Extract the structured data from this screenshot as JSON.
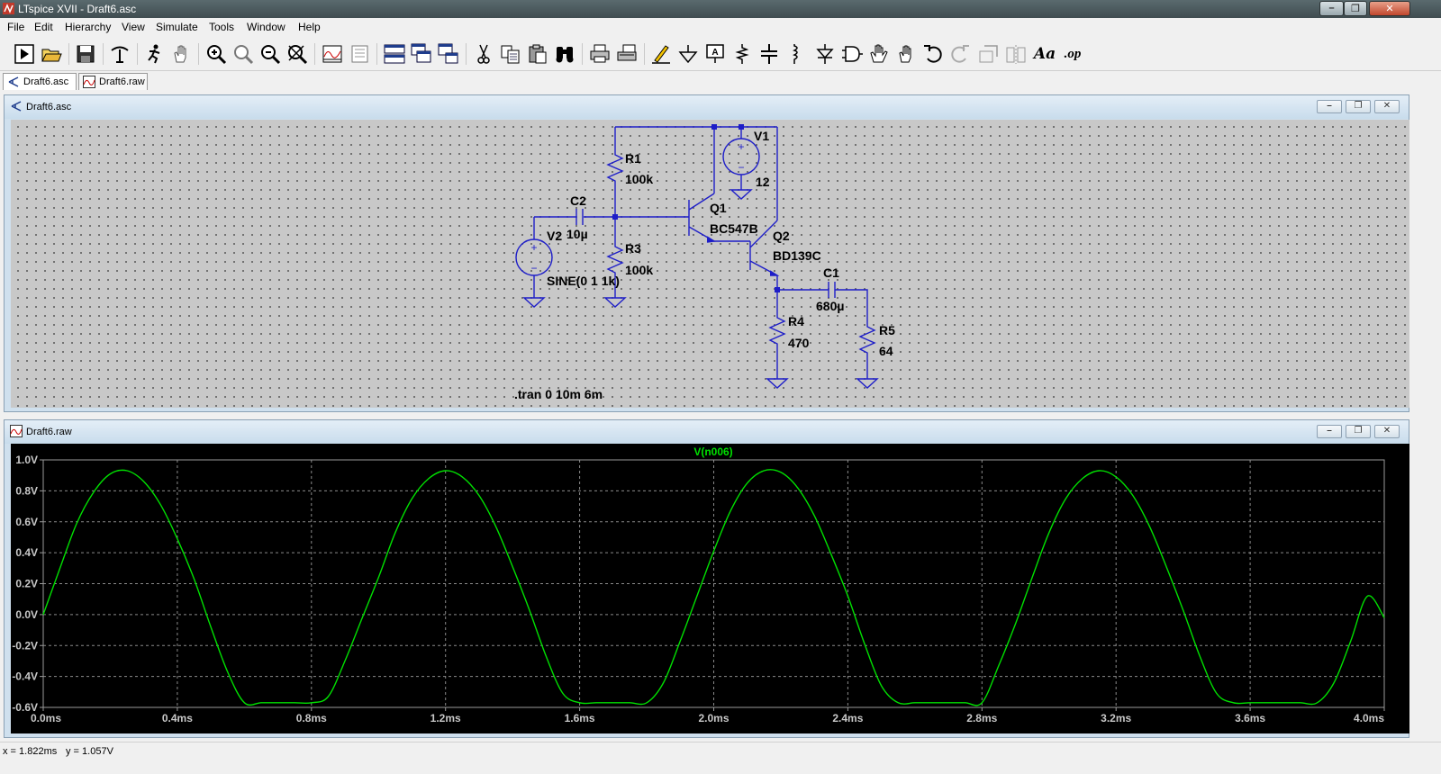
{
  "window": {
    "title": "LTspice XVII - Draft6.asc",
    "min_glyph": "–",
    "max_glyph": "❐",
    "close_glyph": "✕"
  },
  "menu": [
    "File",
    "Edit",
    "Hierarchy",
    "View",
    "Simulate",
    "Tools",
    "Window",
    "Help"
  ],
  "toolbar_icons": [
    "run-icon",
    "open-icon",
    "save-icon",
    "control-panel-icon",
    "halt-icon",
    "pan-icon",
    "zoom-in-icon",
    "zoom-fit-icon",
    "zoom-out-icon",
    "zoom-cancel-icon",
    "autorange-icon",
    "plot-settings-icon",
    "tile-horizontal-icon",
    "cascade-icon",
    "tile-vertical-icon",
    "cut-icon",
    "copy-icon",
    "paste-icon",
    "find-icon",
    "print-icon",
    "print-preview-icon",
    "draw-wire-icon",
    "ground-icon",
    "label-net-icon",
    "resistor-icon",
    "capacitor-icon",
    "inductor-icon",
    "diode-icon",
    "component-icon",
    "move-icon",
    "drag-icon",
    "undo-icon",
    "redo-icon",
    "rotate-icon",
    "mirror-icon",
    "text-icon",
    "spice-directive-icon"
  ],
  "toolbar_text": {
    "text_tool": "Aa",
    "spice_directive": ".op"
  },
  "tabs": [
    {
      "label": "Draft6.asc",
      "icon": "schematic-icon",
      "active": true
    },
    {
      "label": "Draft6.raw",
      "icon": "waveform-icon",
      "active": false
    }
  ],
  "schematic_window": {
    "title": "Draft6.asc",
    "labels": {
      "R1": "R1",
      "R1_val": "100k",
      "R3": "R3",
      "R3_val": "100k",
      "C2": "C2",
      "C2_val": "10µ",
      "V2": "V2",
      "V2_val": "SINE(0 1 1k)",
      "V1": "V1",
      "V1_val": "12",
      "Q1": "Q1",
      "Q1_val": "BC547B",
      "Q2": "Q2",
      "Q2_val": "BD139C",
      "C1": "C1",
      "C1_val": "680µ",
      "R4": "R4",
      "R4_val": "470",
      "R5": "R5",
      "R5_val": "64",
      "directive": ".tran 0 10m 6m",
      "plus": "+",
      "minus": "−"
    }
  },
  "waveform_window": {
    "title": "Draft6.raw",
    "trace_name": "V(n006)",
    "trace_color": "#00e000"
  },
  "chart_data": {
    "type": "line",
    "title": "V(n006)",
    "x_unit": "ms",
    "y_unit": "V",
    "xlim": [
      0.0,
      4.0
    ],
    "ylim": [
      -0.6,
      1.0
    ],
    "x_ticks": [
      "0.0ms",
      "0.4ms",
      "0.8ms",
      "1.2ms",
      "1.6ms",
      "2.0ms",
      "2.4ms",
      "2.8ms",
      "3.2ms",
      "3.6ms",
      "4.0ms"
    ],
    "y_ticks": [
      "1.0V",
      "0.8V",
      "0.6V",
      "0.4V",
      "0.2V",
      "0.0V",
      "-0.2V",
      "-0.4V",
      "-0.6V"
    ],
    "grid": true,
    "series": [
      {
        "name": "V(n006)",
        "color": "#00e000",
        "x": [
          0.0,
          0.05,
          0.1,
          0.15,
          0.2,
          0.25,
          0.3,
          0.35,
          0.4,
          0.45,
          0.5,
          0.55,
          0.6,
          0.65,
          0.7,
          0.75,
          0.8,
          0.85,
          0.9,
          0.95,
          1.0,
          1.05,
          1.1,
          1.15,
          1.2,
          1.25,
          1.3,
          1.35,
          1.4,
          1.45,
          1.5,
          1.55,
          1.6,
          1.65,
          1.7,
          1.75,
          1.8,
          1.85,
          1.9,
          1.95,
          2.0,
          2.05,
          2.1,
          2.15,
          2.2,
          2.25,
          2.3,
          2.35,
          2.4,
          2.45,
          2.5,
          2.55,
          2.6,
          2.65,
          2.7,
          2.75,
          2.8,
          2.85,
          2.9,
          2.95,
          3.0,
          3.05,
          3.1,
          3.15,
          3.2,
          3.25,
          3.3,
          3.35,
          3.4,
          3.45,
          3.5,
          3.55,
          3.6,
          3.65,
          3.7,
          3.75,
          3.8,
          3.85,
          3.9,
          3.95,
          4.0
        ],
        "y": [
          0.0,
          0.3,
          0.59,
          0.79,
          0.91,
          0.93,
          0.86,
          0.71,
          0.49,
          0.23,
          -0.08,
          -0.37,
          -0.57,
          -0.57,
          -0.57,
          -0.57,
          -0.57,
          -0.53,
          -0.3,
          -0.03,
          0.24,
          0.53,
          0.75,
          0.88,
          0.93,
          0.89,
          0.77,
          0.57,
          0.31,
          0.03,
          -0.27,
          -0.51,
          -0.57,
          -0.57,
          -0.57,
          -0.57,
          -0.57,
          -0.44,
          -0.17,
          0.12,
          0.41,
          0.67,
          0.85,
          0.93,
          0.92,
          0.82,
          0.64,
          0.39,
          0.12,
          -0.19,
          -0.46,
          -0.57,
          -0.57,
          -0.57,
          -0.57,
          -0.57,
          -0.57,
          -0.33,
          -0.06,
          0.24,
          0.53,
          0.75,
          0.88,
          0.93,
          0.89,
          0.77,
          0.57,
          0.31,
          0.03,
          -0.27,
          -0.51,
          -0.57,
          -0.57,
          -0.57,
          -0.57,
          -0.57,
          -0.57,
          -0.44,
          -0.17,
          0.12,
          -0.02
        ]
      }
    ]
  },
  "status": {
    "x": "x = 1.822ms",
    "y": "y = 1.057V"
  }
}
